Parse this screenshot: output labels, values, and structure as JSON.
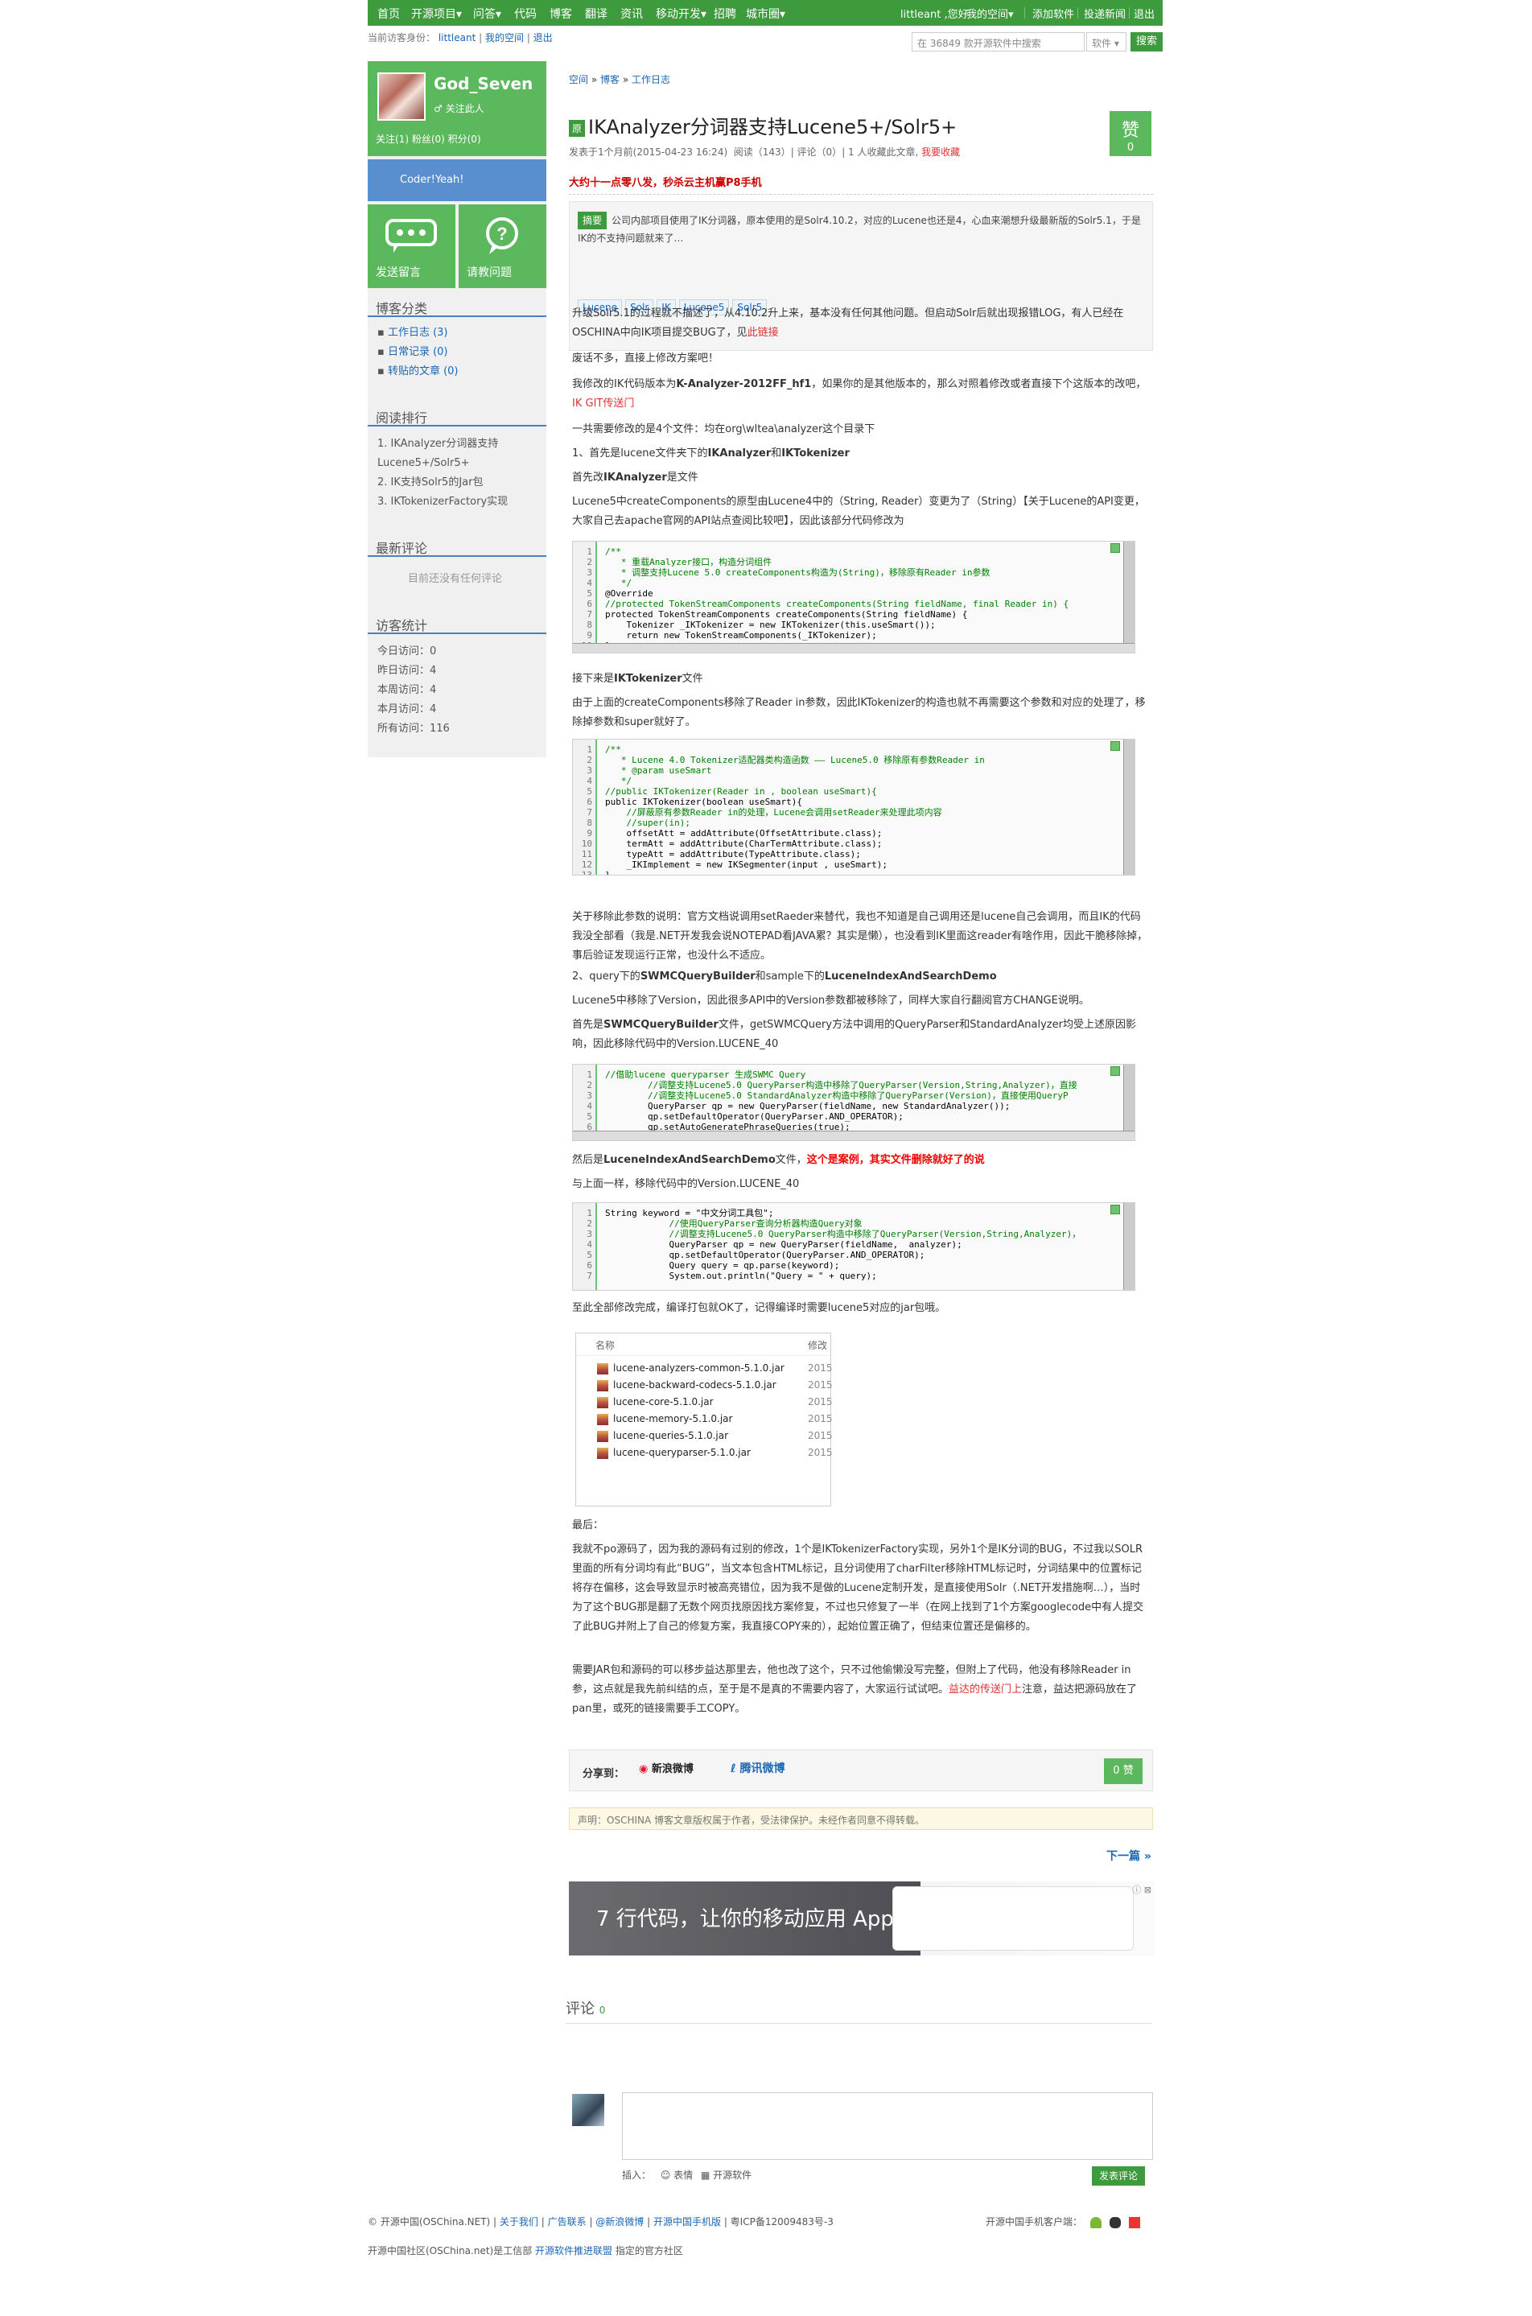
{
  "nav": {
    "items": [
      "首页",
      "开源项目▾",
      "问答▾",
      "代码",
      "博客",
      "翻译",
      "资讯",
      "移动开发▾",
      "招聘",
      "城市圈▾"
    ],
    "user_greeting": "littleant ,您好",
    "my_space": "我的空间▾",
    "add_software": "添加软件",
    "report_bug": "投递新闻",
    "logout": "退出"
  },
  "subbar": {
    "identity_prefix": "当前访客身份：",
    "user": "littleant",
    "my_space": "我的空间",
    "logout": "退出",
    "search_placeholder": "在 36849 款开源软件中搜索",
    "search_scope": "软件 ▾",
    "search_button": "搜索"
  },
  "sidebar": {
    "username": "God_Seven",
    "follow_label": "♂ 关注此人",
    "stats": "关注(1)  粉丝(0)  积分(0)",
    "banner": "Coder!Yeah!",
    "btn_message": "发送留言",
    "btn_ask": "请教问题",
    "categories_title": "博客分类",
    "categories": [
      "工作日志 (3)",
      "日常记录 (0)",
      "转贴的文章 (0)"
    ],
    "ranking_title": "阅读排行",
    "ranking": [
      "1. IKAnalyzer分词器支持",
      "Lucene5+/Solr5+",
      "2. IK支持Solr5的Jar包",
      "3. IKTokenizerFactory实现"
    ],
    "recent_comments_title": "最新评论",
    "recent_comments_empty": "目前还没有任何评论",
    "visits_title": "访客统计",
    "visits": [
      "今日访问：0",
      "昨日访问：4",
      "本周访问：4",
      "本月访问：4",
      "所有访问：116"
    ]
  },
  "article": {
    "breadcrumb": [
      "空间",
      "博客",
      "工作日志"
    ],
    "tag": "原",
    "title": "IKAnalyzer分词器支持Lucene5+/Solr5+",
    "meta_posted": "发表于1个月前(2015-04-23 16:24)",
    "meta_read": "阅读（143）",
    "meta_comments": "评论（0）",
    "meta_fav": "1 人收藏此文章,",
    "meta_fav_action": "我要收藏",
    "zan_label": "赞",
    "zan_count": "0",
    "promo": "大约十一点零八发，秒杀云主机赢P8手机",
    "summary_tag": "摘要",
    "summary": "公司内部项目使用了IK分词器，原本使用的是Solr4.10.2，对应的Lucene也还是4，心血来潮想升级最新版的Solr5.1，于是IK的不支持问题就来了…",
    "keywords": [
      "Lucene",
      "Solr",
      "IK",
      "Lucene5",
      "Solr5"
    ],
    "p1": "升级Solr5.1的过程就不描述了，从4.10.2升上来，基本没有任何其他问题。但启动Solr后就出现报错LOG，有人已经在OSCHINA中向IK项目提交BUG了，见",
    "p1_link": "此链接",
    "p2": "废话不多，直接上修改方案吧！",
    "p3a": "我修改的IK代码版本为",
    "p3b": "K-Analyzer-2012FF_hf1",
    "p3c": "，如果你的是其他版本的，那么对照着修改或者直接下个这版本的改吧，",
    "p3_link": "IK GIT传送门",
    "p4": "一共需要修改的是4个文件：均在org\\wltea\\analyzer这个目录下",
    "p5a": "1、首先是lucene文件夹下的",
    "p5b": "IKAnalyzer",
    "p5c": "和",
    "p5d": "IKTokenizer",
    "p6a": "首先改",
    "p6b": "IKAnalyzer",
    "p6c": "是文件",
    "p7": "Lucene5中createComponents的原型由Lucene4中的（String, Reader）变更为了（String）【关于Lucene的API变更，大家自己去apache官网的API站点查阅比较吧】，因此该部分代码修改为",
    "code1_lines": [
      "/**",
      "   * 重载Analyzer接口，构造分词组件",
      "   * 调整支持Lucene 5.0 createComponents构造为(String)，移除原有Reader in参数",
      "   */",
      "@Override",
      "//protected TokenStreamComponents createComponents(String fieldName, final Reader in) {",
      "protected TokenStreamComponents createComponents(String fieldName) {",
      "    Tokenizer _IKTokenizer = new IKTokenizer(this.useSmart());",
      "    return new TokenStreamComponents(_IKTokenizer);",
      "}"
    ],
    "p8a": "接下来是",
    "p8b": "IKTokenizer",
    "p8c": "文件",
    "p9": "由于上面的createComponents移除了Reader in参数，因此IKTokenizer的构造也就不再需要这个参数和对应的处理了，移除掉参数和super就好了。",
    "code2_lines": [
      "/**",
      "   * Lucene 4.0 Tokenizer适配器类构造函数 —— Lucene5.0 移除原有参数Reader in",
      "   * @param useSmart",
      "   */",
      "//public IKTokenizer(Reader in , boolean useSmart){",
      "public IKTokenizer(boolean useSmart){",
      "    //屏蔽原有参数Reader in的处理，Lucene会调用setReader来处理此项内容",
      "    //super(in);",
      "    offsetAtt = addAttribute(OffsetAttribute.class);",
      "    termAtt = addAttribute(CharTermAttribute.class);",
      "    typeAtt = addAttribute(TypeAttribute.class);",
      "    _IKImplement = new IKSegmenter(input , useSmart);",
      "}"
    ],
    "p10": "关于移除此参数的说明：官方文档说调用setRaeder来替代，我也不知道是自己调用还是lucene自己会调用，而且IK的代码我没全部看（我是.NET开发我会说NOTEPAD看JAVA累？其实是懒），也没看到IK里面这reader有啥作用，因此干脆移除掉，事后验证发现运行正常，也没什么不适应。",
    "p11a": "2、query下的",
    "p11b": "SWMCQueryBuilder",
    "p11c": "和sample下的",
    "p11d": "LuceneIndexAndSearchDemo",
    "p12": "Lucene5中移除了Version，因此很多API中的Version参数都被移除了，同样大家自行翻阅官方CHANGE说明。",
    "p13a": "首先是",
    "p13b": "SWMCQueryBuilder",
    "p13c": "文件，getSWMCQuery方法中调用的QueryParser和StandardAnalyzer均受上述原因影响，因此移除代码中的Version.LUCENE_40",
    "code3_lines": [
      "//借助lucene queryparser 生成SWMC Query",
      "        //调整支持Lucene5.0 QueryParser构造中移除了QueryParser(Version,String,Analyzer)，直接",
      "        //调整支持Lucene5.0 StandardAnalyzer构造中移除了QueryParser(Version)，直接使用QueryP",
      "        QueryParser qp = new QueryParser(fieldName, new StandardAnalyzer());",
      "        qp.setDefaultOperator(QueryParser.AND_OPERATOR);",
      "        qp.setAutoGeneratePhraseQueries(true);"
    ],
    "p14a": "然后是",
    "p14b": "LuceneIndexAndSearchDemo",
    "p14c": "文件，",
    "p14d": "这个是案例，其实文件删除就好了的说",
    "p15": "与上面一样，移除代码中的Version.LUCENE_40",
    "code4_lines": [
      "String keyword = \"中文分词工具包\";",
      "            //使用QueryParser查询分析器构造Query对象",
      "            //调整支持Lucene5.0 QueryParser构造中移除了QueryParser(Version,String,Analyzer)，",
      "            QueryParser qp = new QueryParser(fieldName,  analyzer);",
      "            qp.setDefaultOperator(QueryParser.AND_OPERATOR);",
      "            Query query = qp.parse(keyword);",
      "            System.out.println(\"Query = \" + query);"
    ],
    "p16": "至此全部修改完成，编译打包就OK了，记得编译时需要lucene5对应的jar包哦。",
    "jar_header_name": "名称",
    "jar_header_date": "修改",
    "jars": [
      "lucene-analyzers-common-5.1.0.jar",
      "lucene-backward-codecs-5.1.0.jar",
      "lucene-core-5.1.0.jar",
      "lucene-memory-5.1.0.jar",
      "lucene-queries-5.1.0.jar",
      "lucene-queryparser-5.1.0.jar"
    ],
    "jar_year": "2015",
    "p17": "最后：",
    "p18": "我就不po源码了，因为我的源码有过别的修改，1个是IKTokenizerFactory实现，另外1个是IK分词的BUG，不过我以SOLR里面的所有分词均有此“BUG”，当文本包含HTML标记，且分词使用了charFilter移除HTML标记时，分词结果中的位置标记将存在偏移，这会导致显示时被高亮错位，因为我不是做的Lucene定制开发，是直接使用Solr（.NET开发措施啊…），当时为了这个BUG那是翻了无数个网页找原因找方案修复，不过也只修复了一半（在网上找到了1个方案googlecode中有人提交了此BUG并附上了自己的修复方案，我直接COPY来的），起始位置正确了，但结束位置还是偏移的。",
    "p19a": "需要JAR包和源码的可以移步益达那里去，他也改了这个，只不过他偷懒没写完整，但附上了代码，他没有移除Reader in参，这点就是我先前纠结的点，至于是不是真的不需要内容了，大家运行试试吧。",
    "p19_link": "益达的传送门上",
    "p19b": "注意，益达把源码放在了pan里，或死的链接需要手工COPY。",
    "share_label": "分享到：",
    "share_weibo": "新浪微博",
    "share_tweibo": "腾讯微博",
    "share_zan": "0 赞",
    "notice": "声明：OSCHINA 博客文章版权属于作者，受法律保护。未经作者同意不得转载。",
    "next": "下一篇 »",
    "ad_text": "7 行代码，让你的移动应用 App 接入  Pay",
    "ad_tag": "ⓘ ⊠"
  },
  "comments": {
    "title": "评论",
    "count": "0",
    "insert_label": "插入：",
    "insert_emoji": "☺ 表情",
    "insert_software": "▦ 开源软件",
    "submit": "发表评论"
  },
  "footer": {
    "copyright": "© 开源中国(OSChina.NET) |",
    "links": [
      "关于我们",
      "广告联系",
      "@新浪微博",
      "开源中国手机版"
    ],
    "icp": "| 粤ICP备12009483号-3",
    "mobile_label": "开源中国手机客户端：",
    "line2_prefix": "开源中国社区(OSChina.net)是工信部",
    "line2_link": "开源软件推进联盟",
    "line2_suffix": "指定的官方社区"
  }
}
